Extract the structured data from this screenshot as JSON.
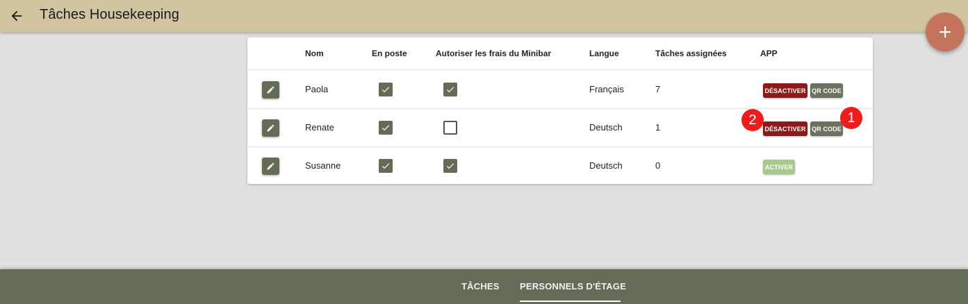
{
  "header": {
    "back_icon": "arrow-left-icon",
    "title": "Tâches Housekeeping"
  },
  "fab": {
    "icon": "plus-icon"
  },
  "table": {
    "columns": [
      "Nom",
      "En poste",
      "Autoriser les frais du Minibar",
      "Langue",
      "Tâches assignées",
      "APP"
    ],
    "rows": [
      {
        "name": "Paola",
        "on_duty": true,
        "minibar": true,
        "language": "Français",
        "tasks": "7",
        "app_primary": "DÉSACTIVER",
        "app_secondary": "QR CODE"
      },
      {
        "name": "Renate",
        "on_duty": true,
        "minibar": false,
        "language": "Deutsch",
        "tasks": "1",
        "app_primary": "DÉSACTIVER",
        "app_secondary": "QR CODE"
      },
      {
        "name": "Susanne",
        "on_duty": true,
        "minibar": true,
        "language": "Deutsch",
        "tasks": "0",
        "app_primary": "ACTIVER"
      }
    ]
  },
  "annotations": {
    "badge_1": "1",
    "badge_2": "2"
  },
  "bottom_nav": {
    "tabs": [
      "TÂCHES",
      "PERSONNELS D'ÉTAGE"
    ],
    "active": "PERSONNELS D'ÉTAGE"
  },
  "colors": {
    "header_bg": "#d3c4a1",
    "fab": "#c4735d",
    "primary_olive": "#646b57",
    "deactivate": "#8b1a1a",
    "activate": "#a8c98d",
    "badge": "#ee1c1c"
  }
}
